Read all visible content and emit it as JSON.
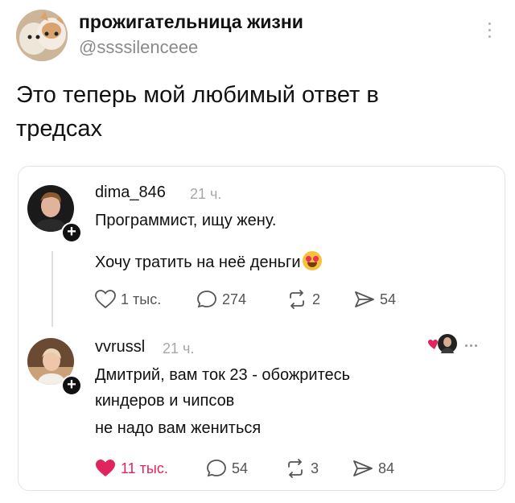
{
  "post": {
    "author_name": "прожигательница жизни",
    "author_handle": "@ssssilenceee",
    "text": "Это теперь мой любимый ответ в тредсах"
  },
  "quoted": {
    "parent": {
      "username": "dima_846",
      "time": "21 ч.",
      "lines": [
        "Программист, ищу жену.",
        "Хочу тратить на неё деньги"
      ],
      "emoji": "smiling-face-with-heart-eyes",
      "actions": {
        "likes": "1 тыс.",
        "comments": "274",
        "reposts": "2",
        "shares": "54"
      }
    },
    "reply": {
      "username": "vvrussl",
      "time": "21 ч.",
      "lines": [
        "Дмитрий, вам ток 23 - обожритесь",
        "киндеров и чипсов",
        "не надо вам жениться"
      ],
      "actions": {
        "likes": "11 тыс.",
        "comments": "54",
        "reposts": "3",
        "shares": "84"
      },
      "liked": true
    }
  },
  "colors": {
    "like": "#e0245e",
    "muted": "#8a8a8a",
    "text": "#111111",
    "border": "#e4e4e4"
  }
}
